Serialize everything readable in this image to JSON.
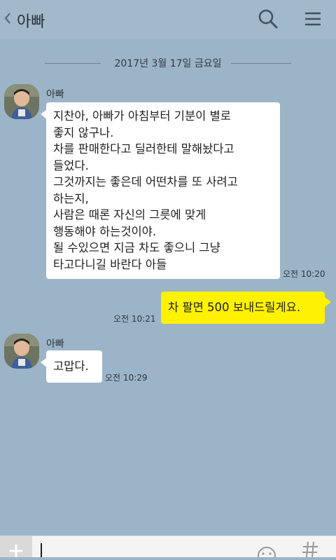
{
  "header": {
    "title": "아빠",
    "back_icon": "chevron-left-icon",
    "search_icon": "search-icon",
    "menu_icon": "hamburger-menu-icon"
  },
  "date_divider": "2017년 3월 17일 금요일",
  "messages": [
    {
      "sender": "아빠",
      "lines": [
        "지찬아, 아빠가 아침부터 기분이 별로",
        "좋지 않구나.",
        "차를 판매한다고 딜러한테 말해놨다고",
        "들었다.",
        "그것까지는 좋은데 어떤차를 또 사려고",
        "하는지,",
        "사람은 때론 자신의 그릇에 맞게",
        "행동해야 하는것이야.",
        "될 수있으면 지금 차도 좋으니 그냥",
        "타고다니길 바란다 아들"
      ],
      "time": "오전 10:20"
    },
    {
      "sender": "",
      "text": "차 팔면 500 보내드릴게요.",
      "time": "오전 10:21"
    },
    {
      "sender": "아빠",
      "text": "고맙다.",
      "time": "오전 10:29"
    }
  ],
  "colors": {
    "background": "#9bb4c8",
    "my_bubble": "#fff200",
    "their_bubble": "#ffffff"
  }
}
